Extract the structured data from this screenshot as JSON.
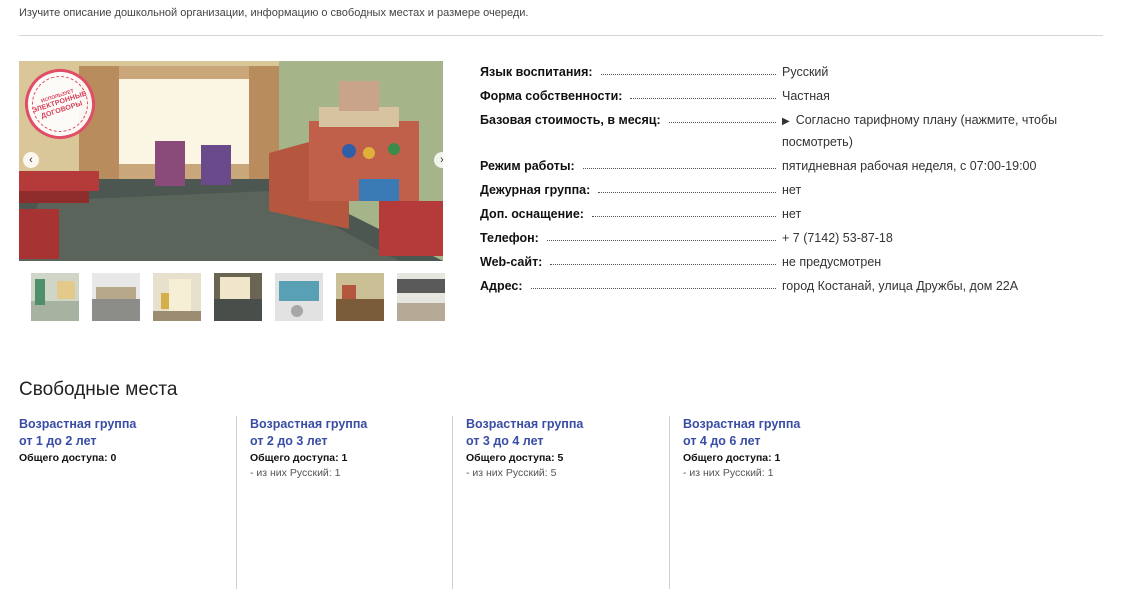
{
  "intro_text": "Изучите описание дошкольной организации, информацию о свободных местах и размере очереди.",
  "gallery": {
    "stamp_top": "ИСПОЛЬЗУЕТ",
    "stamp_line1": "ЭЛЕКТРОННЫЕ",
    "stamp_line2": "ДОГОВОРЫ",
    "prev_arrow": "‹",
    "next_arrow": "›",
    "thumbnail_count": 7
  },
  "info": [
    {
      "label": "Язык воспитания:",
      "value": "Русский"
    },
    {
      "label": "Форма собственности:",
      "value": "Частная"
    },
    {
      "label": "Базовая стоимость, в месяц:",
      "value": "Согласно тарифному плану (нажмите, чтобы посмотреть)",
      "toggle": "▶"
    },
    {
      "label": "Режим работы:",
      "value": "пятидневная рабочая неделя, с 07:00-19:00"
    },
    {
      "label": "Дежурная группа:",
      "value": "нет"
    },
    {
      "label": "Доп. оснащение:",
      "value": "нет"
    },
    {
      "label": "Телефон:",
      "value": "+ 7 (7142) 53-87-18"
    },
    {
      "label": "Web-сайт:",
      "value": "не предусмотрен"
    },
    {
      "label": "Адрес:",
      "value": "город Костанай, улица Дружбы, дом 22А"
    }
  ],
  "free_places": {
    "title": "Свободные места",
    "groups": [
      {
        "line1": "Возрастная группа",
        "line2": "от 1 до 2 лет",
        "common": "Общего доступа: 0",
        "sub": ""
      },
      {
        "line1": "Возрастная группа",
        "line2": "от 2 до 3 лет",
        "common": "Общего доступа: 1",
        "sub": "- из них Русский: 1"
      },
      {
        "line1": "Возрастная группа",
        "line2": "от 3 до 4 лет",
        "common": "Общего доступа: 5",
        "sub": "- из них Русский: 5"
      },
      {
        "line1": "Возрастная группа",
        "line2": "от 4 до 6 лет",
        "common": "Общего доступа: 1",
        "sub": "- из них Русский: 1"
      }
    ]
  }
}
